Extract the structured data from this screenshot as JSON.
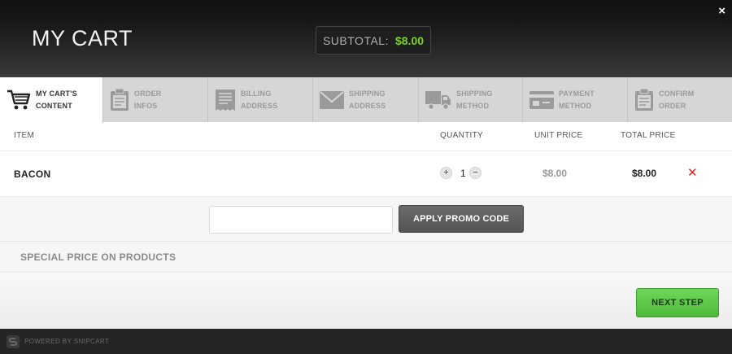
{
  "header": {
    "title": "MY CART",
    "subtotal_label": "SUBTOTAL:",
    "subtotal_value": "$8.00",
    "close_label": "×"
  },
  "steps": [
    {
      "label": "MY CART'S CONTENT",
      "line1": "MY CART'S",
      "line2": "CONTENT",
      "icon": "cart-icon",
      "active": true
    },
    {
      "label": "ORDER INFOS",
      "line1": "ORDER INFOS",
      "line2": "",
      "icon": "clipboard-icon",
      "active": false
    },
    {
      "label": "BILLING ADDRESS",
      "line1": "BILLING",
      "line2": "ADDRESS",
      "icon": "receipt-icon",
      "active": false
    },
    {
      "label": "SHIPPING ADDRESS",
      "line1": "SHIPPING",
      "line2": "ADDRESS",
      "icon": "envelope-icon",
      "active": false
    },
    {
      "label": "SHIPPING METHOD",
      "line1": "SHIPPING",
      "line2": "METHOD",
      "icon": "truck-icon",
      "active": false
    },
    {
      "label": "PAYMENT METHOD",
      "line1": "PAYMENT",
      "line2": "METHOD",
      "icon": "credit-card-icon",
      "active": false
    },
    {
      "label": "CONFIRM ORDER",
      "line1": "CONFIRM",
      "line2": "ORDER",
      "icon": "clipboard-check-icon",
      "active": false
    }
  ],
  "table": {
    "columns": [
      "ITEM",
      "QUANTITY",
      "UNIT PRICE",
      "TOTAL PRICE"
    ],
    "rows": [
      {
        "item": "BACON",
        "quantity": "1",
        "unit_price": "$8.00",
        "total_price": "$8.00"
      }
    ],
    "increment_label": "+",
    "decrement_label": "−",
    "remove_label": "✕"
  },
  "promo": {
    "input_value": "",
    "input_placeholder": "",
    "button_label": "APPLY PROMO CODE"
  },
  "special_price": "SPECIAL PRICE ON PRODUCTS",
  "next_step_label": "NEXT STEP",
  "powered_by": "POWERED BY SNIPCART",
  "colors": {
    "accent_green": "#7ed321",
    "next_button": "#5cc849",
    "remove_red": "#e02020",
    "header_dark": "#1c1c1c"
  }
}
